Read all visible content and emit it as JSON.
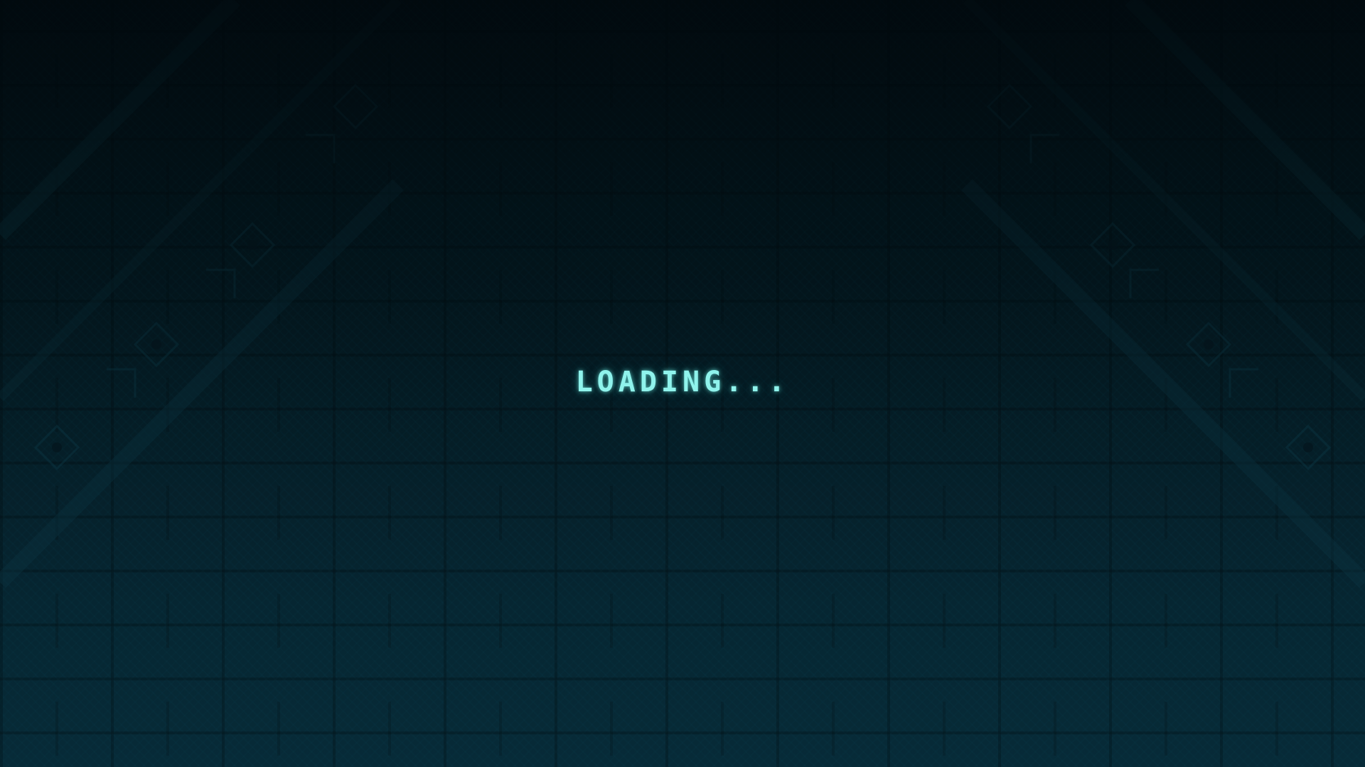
{
  "screen": {
    "loading_text": "LOADING..."
  },
  "colors": {
    "text": "#8ff3ec",
    "background_top": "#03151c",
    "background_bottom": "#072b38"
  }
}
